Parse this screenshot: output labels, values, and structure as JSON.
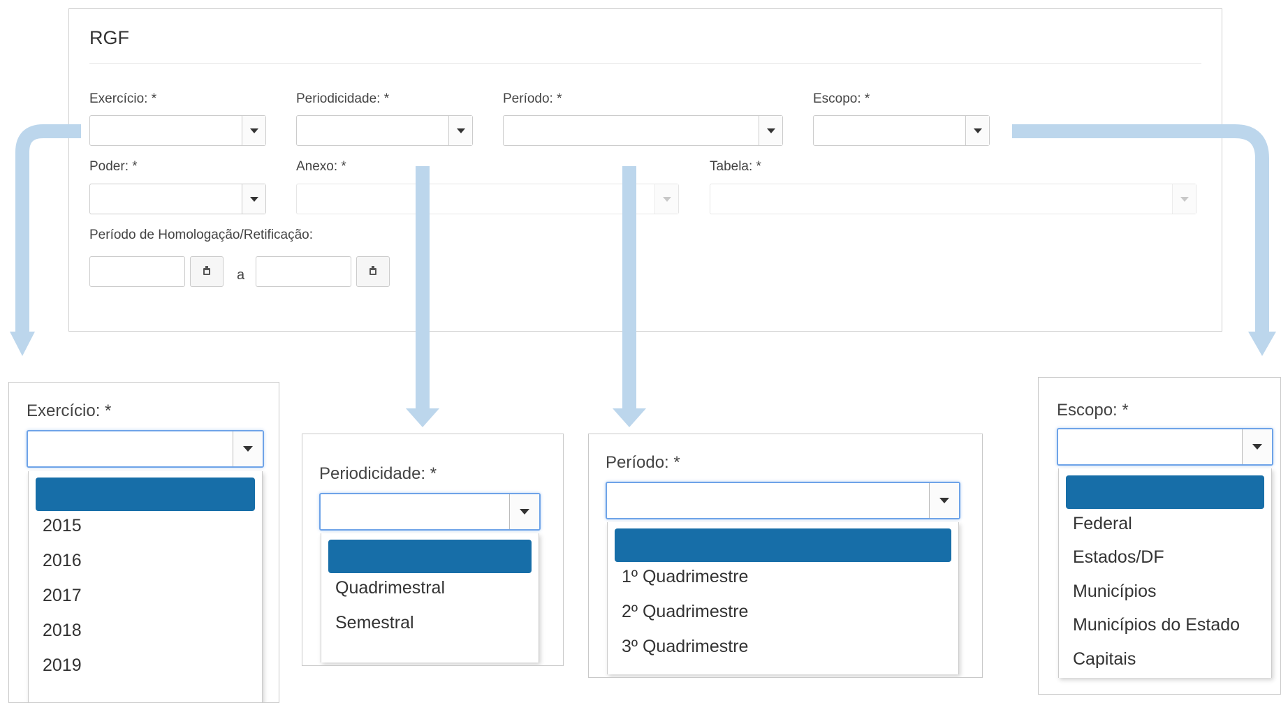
{
  "form": {
    "title": "RGF",
    "labels": {
      "exercicio": "Exercício: *",
      "periodicidade": "Periodicidade: *",
      "periodo": "Período: *",
      "escopo": "Escopo: *",
      "poder": "Poder: *",
      "anexo": "Anexo: *",
      "tabela": "Tabela: *",
      "homologacao": "Período de Homologação/Retificação:"
    },
    "date_separator": "a"
  },
  "dropdowns": {
    "exercicio": {
      "label": "Exercício: *",
      "options": [
        "",
        "2015",
        "2016",
        "2017",
        "2018",
        "2019"
      ]
    },
    "periodicidade": {
      "label": "Periodicidade: *",
      "options": [
        "",
        "Quadrimestral",
        "Semestral"
      ]
    },
    "periodo": {
      "label": "Período: *",
      "options": [
        "",
        "1º Quadrimestre",
        "2º Quadrimestre",
        "3º Quadrimestre"
      ]
    },
    "escopo": {
      "label": "Escopo: *",
      "options": [
        "",
        "Federal",
        "Estados/DF",
        "Municípios",
        "Municípios do Estado",
        "Capitais"
      ]
    }
  },
  "colors": {
    "highlight": "#176ea8",
    "arrow": "#bcd6ec",
    "focus_border": "#6ea3e8"
  },
  "icons": {
    "dropdown": "caret-down-icon",
    "calendar": "calendar-icon"
  }
}
